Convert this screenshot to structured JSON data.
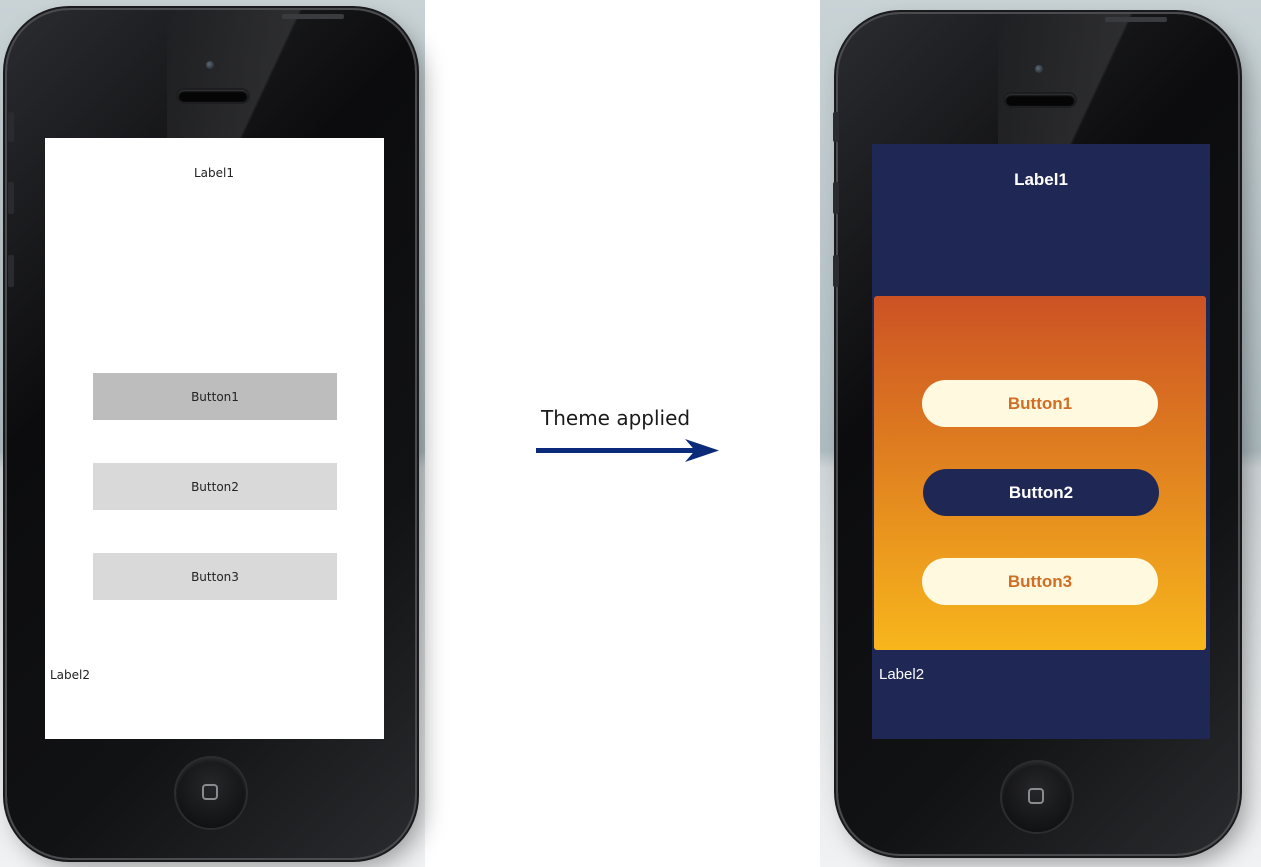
{
  "before": {
    "label1": "Label1",
    "buttons": [
      "Button1",
      "Button2",
      "Button3"
    ],
    "label2": "Label2"
  },
  "caption": "Theme applied",
  "after": {
    "label1": "Label1",
    "buttons": [
      "Button1",
      "Button2",
      "Button3"
    ],
    "label2": "Label2"
  },
  "colors": {
    "arrow": "#0b2b7a",
    "themed_background": "#1f2754",
    "gradient_top": "#cc5224",
    "gradient_bottom": "#f8b61c",
    "pill_cream": "#fff9df",
    "pill_text_orange": "#d06e25"
  }
}
